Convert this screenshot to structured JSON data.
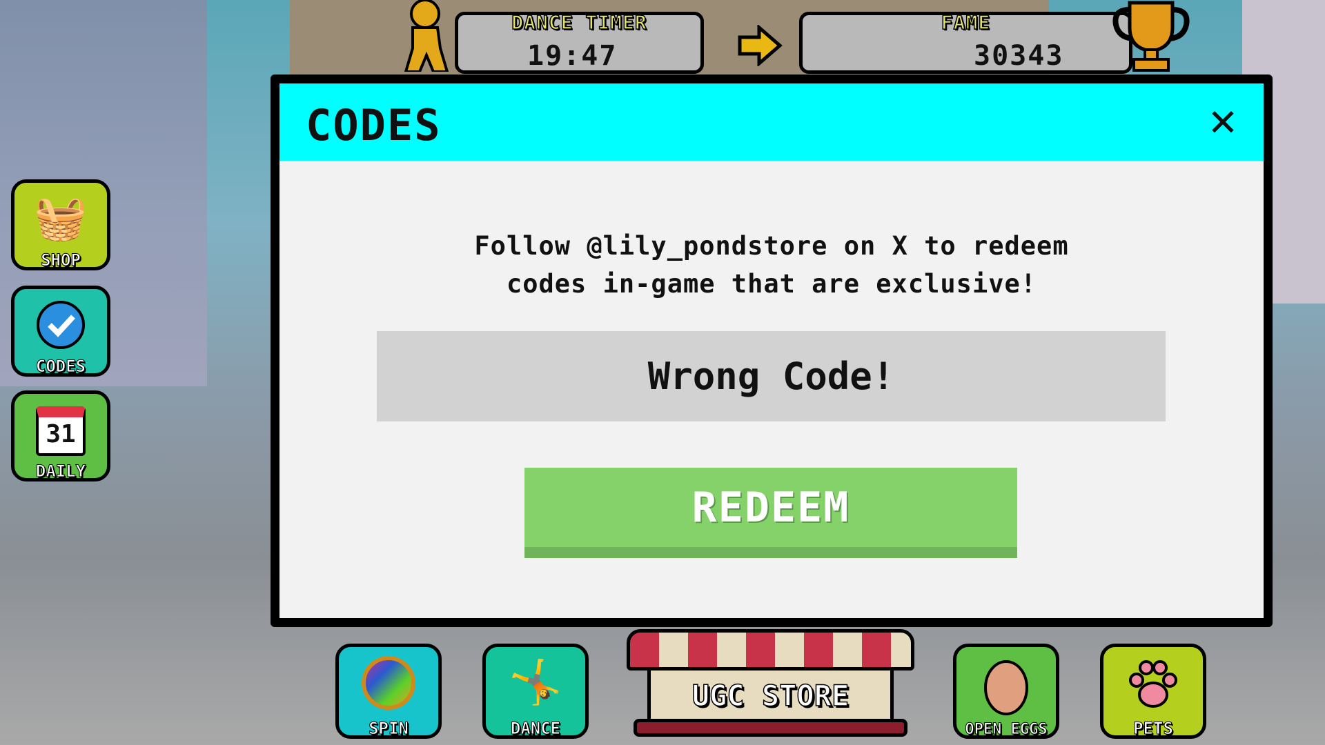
{
  "hud": {
    "dance_timer": {
      "label": "DANCE TIMER",
      "value": "19:47"
    },
    "fame": {
      "label": "FAME",
      "value": "30343"
    }
  },
  "modal": {
    "title": "CODES",
    "close_icon": "close-x-icon",
    "description_line1": "Follow @lily_pondstore on X to redeem",
    "description_line2": "codes in-game that are exclusive!",
    "input_value": "Wrong Code!",
    "redeem_label": "REDEEM",
    "header_color": "#00ffff",
    "redeem_color": "#85d16a"
  },
  "sidebar": [
    {
      "label": "SHOP",
      "icon": "basket-icon",
      "color": "#b5cf1e"
    },
    {
      "label": "CODES",
      "icon": "verified-check-icon",
      "color": "#1fc2a9"
    },
    {
      "label": "DAILY",
      "icon": "calendar-icon",
      "calendar_day": "31",
      "color": "#5fbf45"
    }
  ],
  "bottom_bar": [
    {
      "label": "SPIN",
      "icon": "spin-wheel-icon",
      "color": "#17c4cc"
    },
    {
      "label": "DANCE",
      "icon": "dancer-icon",
      "color": "#14c39a"
    },
    {
      "label": "UGC STORE",
      "icon": "storefront-icon"
    },
    {
      "label": "OPEN EGGS",
      "icon": "egg-icon",
      "color": "#5fbf45"
    },
    {
      "label": "PETS",
      "icon": "paw-icon",
      "color": "#b5cf1e"
    }
  ]
}
